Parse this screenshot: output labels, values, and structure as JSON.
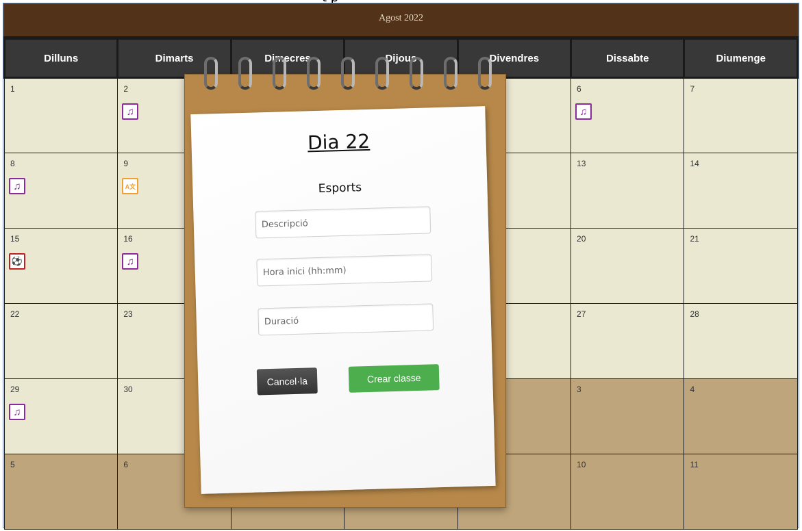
{
  "header": {
    "title_fragment": "t p",
    "month": "Agost 2022"
  },
  "weekdays": [
    "Dilluns",
    "Dimarts",
    "Dimecres",
    "Dijous",
    "Divendres",
    "Dissabte",
    "Diumenge"
  ],
  "weeks": [
    [
      {
        "d": "1"
      },
      {
        "d": "2",
        "icon": "music"
      },
      {
        "d": ""
      },
      {
        "d": ""
      },
      {
        "d": ""
      },
      {
        "d": "6",
        "icon": "music"
      },
      {
        "d": "7"
      }
    ],
    [
      {
        "d": "8",
        "icon": "music"
      },
      {
        "d": "9",
        "icon": "lang"
      },
      {
        "d": ""
      },
      {
        "d": ""
      },
      {
        "d": ""
      },
      {
        "d": "13"
      },
      {
        "d": "14"
      }
    ],
    [
      {
        "d": "15",
        "icon": "sport"
      },
      {
        "d": "16",
        "icon": "music"
      },
      {
        "d": ""
      },
      {
        "d": ""
      },
      {
        "d": ""
      },
      {
        "d": "20"
      },
      {
        "d": "21"
      }
    ],
    [
      {
        "d": "22"
      },
      {
        "d": "23"
      },
      {
        "d": ""
      },
      {
        "d": ""
      },
      {
        "d": ""
      },
      {
        "d": "27"
      },
      {
        "d": "28"
      }
    ],
    [
      {
        "d": "29",
        "icon": "music"
      },
      {
        "d": "30"
      },
      {
        "d": ""
      },
      {
        "d": "",
        "other": true
      },
      {
        "d": "",
        "other": true
      },
      {
        "d": "3",
        "other": true
      },
      {
        "d": "4",
        "other": true
      }
    ],
    [
      {
        "d": "5",
        "other": true
      },
      {
        "d": "6",
        "other": true
      },
      {
        "d": "",
        "other": true
      },
      {
        "d": "",
        "other": true
      },
      {
        "d": "",
        "other": true
      },
      {
        "d": "10",
        "other": true
      },
      {
        "d": "11",
        "other": true
      }
    ]
  ],
  "icons": {
    "music": {
      "glyph": "♫",
      "name": "music-note-icon"
    },
    "lang": {
      "glyph": "A文",
      "name": "language-class-icon"
    },
    "sport": {
      "glyph": "⚽",
      "name": "sports-icon"
    }
  },
  "modal": {
    "day_title": "Dia 22",
    "category": "Esports",
    "desc_placeholder": "Descripció",
    "start_placeholder": "Hora inici (hh:mm)",
    "duration_placeholder": "Duració",
    "cancel_label": "Cancel·la",
    "create_label": "Crear classe"
  },
  "colors": {
    "month_bar": "#523319",
    "weekday_header": "#383838",
    "cell": "#ebe8d2",
    "other_month_cell": "#bfa57b",
    "create_button": "#4cae4c"
  }
}
